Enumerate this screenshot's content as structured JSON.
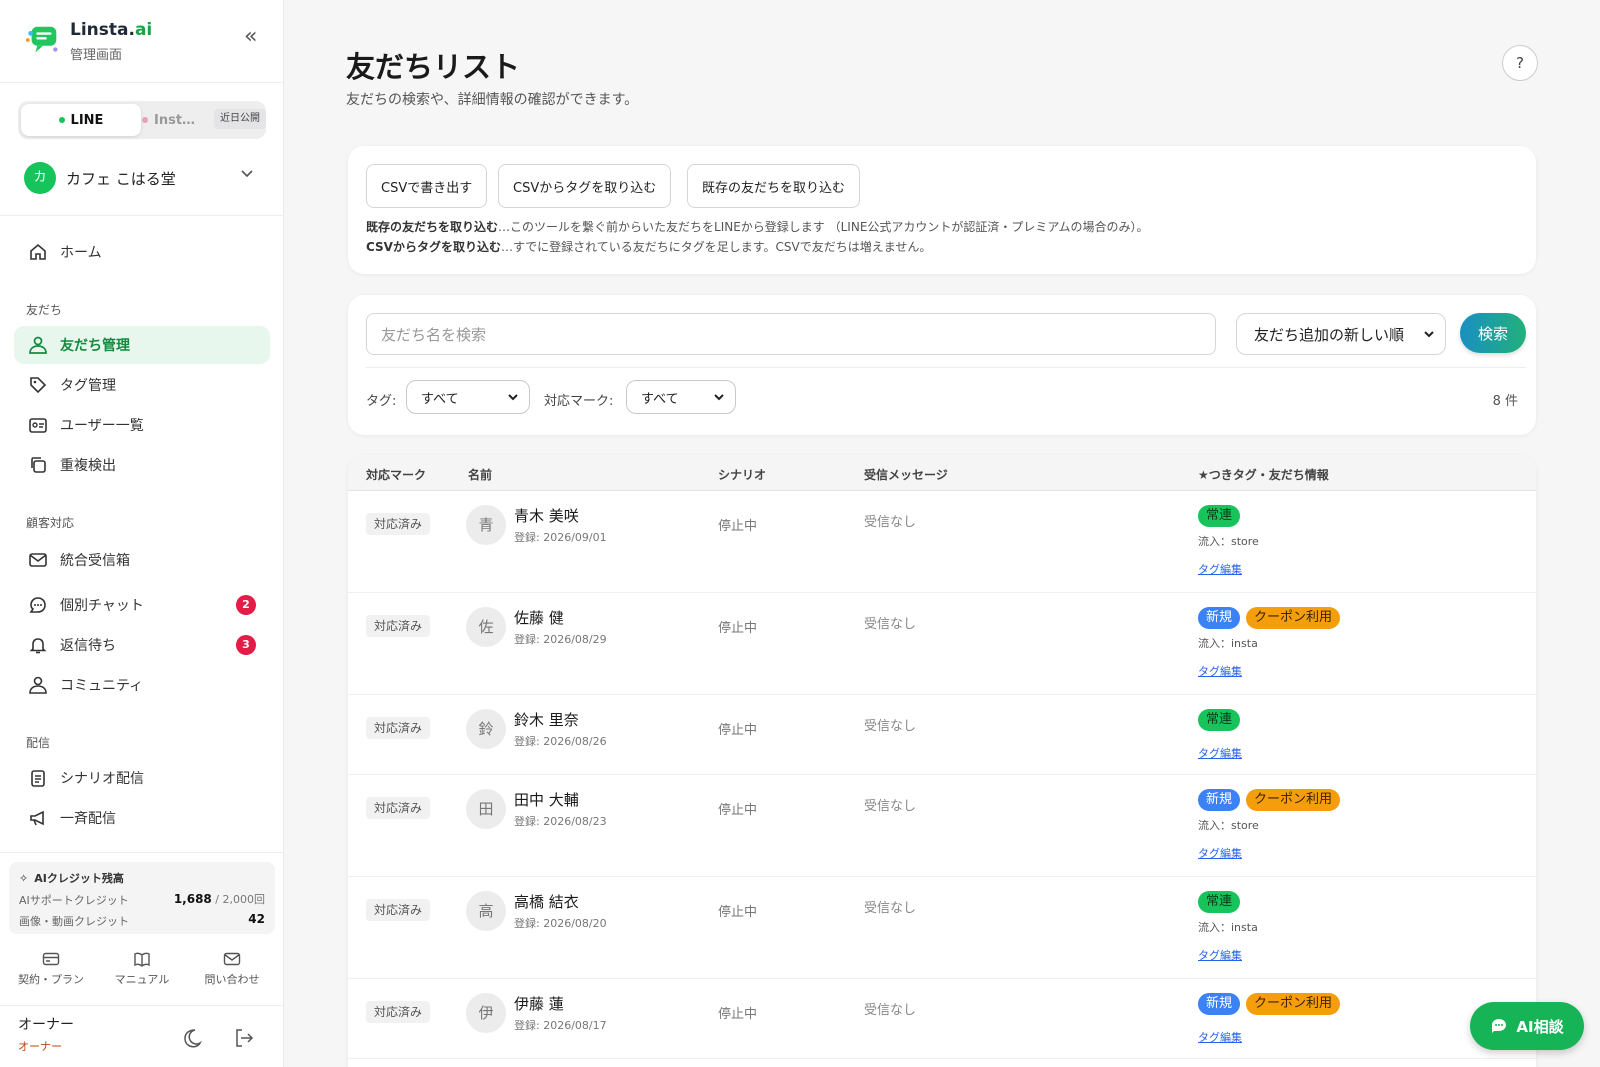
{
  "brand": {
    "name_main": "Linsta.",
    "name_accent": "ai",
    "subtitle": "管理画面"
  },
  "channels": {
    "line_label": "LINE",
    "insta_label": "Inst…",
    "soon_label": "近日公開"
  },
  "store": {
    "initial": "カ",
    "name": "カフェ こはる堂"
  },
  "nav": {
    "home": "ホーム",
    "section_friends": "友だち",
    "friends_manage": "友だち管理",
    "tag_manage": "タグ管理",
    "user_list": "ユーザー一覧",
    "duplicate": "重複検出",
    "section_customer": "顧客対応",
    "inbox": "統合受信箱",
    "chat": "個別チャット",
    "chat_badge": "2",
    "waiting": "返信待ち",
    "waiting_badge": "3",
    "community": "コミュニティ",
    "section_delivery": "配信",
    "scenario": "シナリオ配信",
    "broadcast": "一斉配信"
  },
  "credits": {
    "title": "AIクレジット残高",
    "support_label": "AIサポートクレジット",
    "support_value": "1,688",
    "support_total": " / 2,000回",
    "media_label": "画像・動画クレジット",
    "media_value": "42"
  },
  "footer": {
    "plan": "契約・プラン",
    "manual": "マニュアル",
    "contact": "問い合わせ",
    "owner_name": "オーナー",
    "owner_role": "オーナー"
  },
  "header": {
    "title": "友だちリスト",
    "subtitle": "友だちの検索や、詳細情報の確認ができます。",
    "help": "?"
  },
  "tools": {
    "export_csv": "CSVで書き出す",
    "import_tags": "CSVからタグを取り込む",
    "import_friends": "既存の友だちを取り込む",
    "note1_bold": "既存の友だちを取り込む",
    "note1_text": "…このツールを繋ぐ前からいた友だちをLINEから登録します （LINE公式アカウントが認証済・プレミアムの場合のみ）。",
    "note2_bold": "CSVからタグを取り込む",
    "note2_text": "…すでに登録されている友だちにタグを足します。CSVで友だちは増えません。"
  },
  "search": {
    "placeholder": "友だち名を検索",
    "sort_value": "友だち追加の新しい順",
    "button": "検索",
    "tag_label": "タグ:",
    "tag_value": "すべて",
    "mark_label": "対応マーク:",
    "mark_value": "すべて",
    "count": "8 件"
  },
  "table": {
    "headers": [
      "対応マーク",
      "名前",
      "シナリオ",
      "受信メッセージ",
      "★つきタグ・友だち情報"
    ],
    "tag_edit_label": "タグ編集",
    "rows": [
      {
        "status": "対応済み",
        "initial": "青",
        "name": "青木 美咲",
        "registered": "登録: 2026/09/01",
        "scenario": "停止中",
        "message": "受信なし",
        "tags": [
          {
            "label": "常連",
            "color": "green"
          }
        ],
        "inflow": "流入：store"
      },
      {
        "status": "対応済み",
        "initial": "佐",
        "name": "佐藤 健",
        "registered": "登録: 2026/08/29",
        "scenario": "停止中",
        "message": "受信なし",
        "tags": [
          {
            "label": "新規",
            "color": "blue"
          },
          {
            "label": "クーポン利用",
            "color": "orange"
          }
        ],
        "inflow": "流入：insta"
      },
      {
        "status": "対応済み",
        "initial": "鈴",
        "name": "鈴木 里奈",
        "registered": "登録: 2026/08/26",
        "scenario": "停止中",
        "message": "受信なし",
        "tags": [
          {
            "label": "常連",
            "color": "green"
          }
        ],
        "inflow": ""
      },
      {
        "status": "対応済み",
        "initial": "田",
        "name": "田中 大輔",
        "registered": "登録: 2026/08/23",
        "scenario": "停止中",
        "message": "受信なし",
        "tags": [
          {
            "label": "新規",
            "color": "blue"
          },
          {
            "label": "クーポン利用",
            "color": "orange"
          }
        ],
        "inflow": "流入：store"
      },
      {
        "status": "対応済み",
        "initial": "高",
        "name": "高橋 結衣",
        "registered": "登録: 2026/08/20",
        "scenario": "停止中",
        "message": "受信なし",
        "tags": [
          {
            "label": "常連",
            "color": "green"
          }
        ],
        "inflow": "流入：insta"
      },
      {
        "status": "対応済み",
        "initial": "伊",
        "name": "伊藤 蓮",
        "registered": "登録: 2026/08/17",
        "scenario": "停止中",
        "message": "受信なし",
        "tags": [
          {
            "label": "新規",
            "color": "blue"
          },
          {
            "label": "クーポン利用",
            "color": "orange"
          }
        ],
        "inflow": ""
      }
    ]
  },
  "fab": {
    "label": "AI相談"
  },
  "colors": {
    "accent_green": "#16c45b",
    "active_bg": "#e8f7ed",
    "badge_red": "#e11d48",
    "tag_blue": "#3b82f6",
    "tag_orange": "#f59e0b"
  }
}
